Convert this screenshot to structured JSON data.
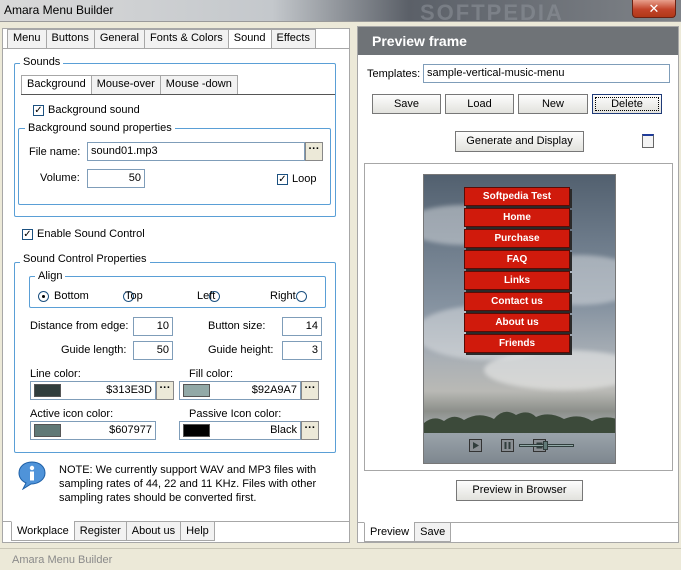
{
  "window": {
    "title": "Amara Menu Builder",
    "watermark": "SOFTPEDIA",
    "close_glyph": "✕"
  },
  "top_tabs": [
    {
      "label": "Menu"
    },
    {
      "label": "Buttons"
    },
    {
      "label": "General"
    },
    {
      "label": "Fonts & Colors"
    },
    {
      "label": "Sound",
      "active": true
    },
    {
      "label": "Effects"
    }
  ],
  "sounds": {
    "title": "Sounds",
    "subtabs": [
      {
        "label": "Background",
        "active": true
      },
      {
        "label": "Mouse-over"
      },
      {
        "label": "Mouse -down"
      }
    ],
    "background_sound_label": "Background sound",
    "background_sound_checked": true,
    "props_title": "Background sound properties",
    "file_name_label": "File name:",
    "file_name_value": "sound01.mp3",
    "volume_label": "Volume:",
    "volume_value": "50",
    "loop_label": "Loop",
    "loop_checked": true
  },
  "enable_sound_control": {
    "label": "Enable Sound Control",
    "checked": true
  },
  "sound_control": {
    "title": "Sound Control  Properties",
    "align_title": "Align",
    "align_options": [
      {
        "label": "Bottom",
        "selected": true
      },
      {
        "label": "Top"
      },
      {
        "label": "Left"
      },
      {
        "label": "Right"
      }
    ],
    "distance_label": "Distance from edge:",
    "distance_value": "10",
    "button_size_label": "Button size:",
    "button_size_value": "14",
    "guide_length_label": "Guide length:",
    "guide_length_value": "50",
    "guide_height_label": "Guide height:",
    "guide_height_value": "3",
    "line_color_label": "Line color:",
    "line_color_value": "$313E3D",
    "line_color_hex": "#3d3e31",
    "fill_color_label": "Fill color:",
    "fill_color_value": "$92A9A7",
    "fill_color_hex": "#a7a992",
    "active_icon_label": "Active icon color:",
    "active_icon_value": "$607977",
    "active_icon_hex": "#777960",
    "passive_icon_label": "Passive Icon color:",
    "passive_icon_value": "Black",
    "passive_icon_hex": "#000000"
  },
  "note": {
    "text": "NOTE: We currently support WAV and MP3 files with sampling rates of 44, 22 and 11 KHz. Files with other sampling rates should be converted first.",
    "icon": "info-icon"
  },
  "bottom_left_tabs": [
    {
      "label": "Workplace",
      "active": true
    },
    {
      "label": "Register"
    },
    {
      "label": "About us"
    },
    {
      "label": "Help"
    }
  ],
  "preview": {
    "header": "Preview frame",
    "templates_label": "Templates:",
    "templates_value": "sample-vertical-music-menu",
    "buttons": {
      "save": "Save",
      "load": "Load",
      "new": "New",
      "delete": "Delete"
    },
    "generate_label": "Generate and Display",
    "menu_items": [
      "Softpedia Test",
      "Home",
      "Purchase",
      "FAQ",
      "Links",
      "Contact us",
      "About us",
      "Friends"
    ],
    "menu_item_color": "#d01a0c",
    "preview_browser_label": "Preview in Browser"
  },
  "bottom_right_tabs": [
    {
      "label": "Preview",
      "active": true
    },
    {
      "label": "Save"
    }
  ],
  "statusbar": {
    "text": "Amara Menu Builder"
  }
}
